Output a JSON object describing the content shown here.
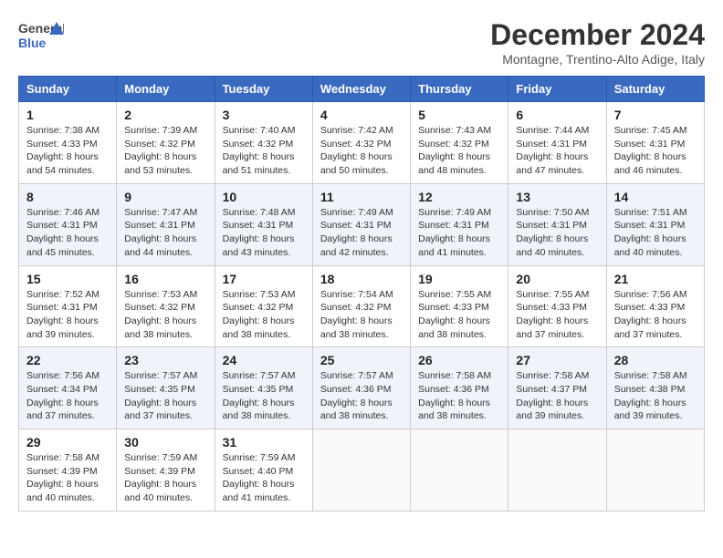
{
  "header": {
    "logo_line1": "General",
    "logo_line2": "Blue",
    "month": "December 2024",
    "location": "Montagne, Trentino-Alto Adige, Italy"
  },
  "days_of_week": [
    "Sunday",
    "Monday",
    "Tuesday",
    "Wednesday",
    "Thursday",
    "Friday",
    "Saturday"
  ],
  "weeks": [
    [
      {
        "day": "1",
        "sunrise": "7:38 AM",
        "sunset": "4:33 PM",
        "daylight": "8 hours and 54 minutes."
      },
      {
        "day": "2",
        "sunrise": "7:39 AM",
        "sunset": "4:32 PM",
        "daylight": "8 hours and 53 minutes."
      },
      {
        "day": "3",
        "sunrise": "7:40 AM",
        "sunset": "4:32 PM",
        "daylight": "8 hours and 51 minutes."
      },
      {
        "day": "4",
        "sunrise": "7:42 AM",
        "sunset": "4:32 PM",
        "daylight": "8 hours and 50 minutes."
      },
      {
        "day": "5",
        "sunrise": "7:43 AM",
        "sunset": "4:32 PM",
        "daylight": "8 hours and 48 minutes."
      },
      {
        "day": "6",
        "sunrise": "7:44 AM",
        "sunset": "4:31 PM",
        "daylight": "8 hours and 47 minutes."
      },
      {
        "day": "7",
        "sunrise": "7:45 AM",
        "sunset": "4:31 PM",
        "daylight": "8 hours and 46 minutes."
      }
    ],
    [
      {
        "day": "8",
        "sunrise": "7:46 AM",
        "sunset": "4:31 PM",
        "daylight": "8 hours and 45 minutes."
      },
      {
        "day": "9",
        "sunrise": "7:47 AM",
        "sunset": "4:31 PM",
        "daylight": "8 hours and 44 minutes."
      },
      {
        "day": "10",
        "sunrise": "7:48 AM",
        "sunset": "4:31 PM",
        "daylight": "8 hours and 43 minutes."
      },
      {
        "day": "11",
        "sunrise": "7:49 AM",
        "sunset": "4:31 PM",
        "daylight": "8 hours and 42 minutes."
      },
      {
        "day": "12",
        "sunrise": "7:49 AM",
        "sunset": "4:31 PM",
        "daylight": "8 hours and 41 minutes."
      },
      {
        "day": "13",
        "sunrise": "7:50 AM",
        "sunset": "4:31 PM",
        "daylight": "8 hours and 40 minutes."
      },
      {
        "day": "14",
        "sunrise": "7:51 AM",
        "sunset": "4:31 PM",
        "daylight": "8 hours and 40 minutes."
      }
    ],
    [
      {
        "day": "15",
        "sunrise": "7:52 AM",
        "sunset": "4:31 PM",
        "daylight": "8 hours and 39 minutes."
      },
      {
        "day": "16",
        "sunrise": "7:53 AM",
        "sunset": "4:32 PM",
        "daylight": "8 hours and 38 minutes."
      },
      {
        "day": "17",
        "sunrise": "7:53 AM",
        "sunset": "4:32 PM",
        "daylight": "8 hours and 38 minutes."
      },
      {
        "day": "18",
        "sunrise": "7:54 AM",
        "sunset": "4:32 PM",
        "daylight": "8 hours and 38 minutes."
      },
      {
        "day": "19",
        "sunrise": "7:55 AM",
        "sunset": "4:33 PM",
        "daylight": "8 hours and 38 minutes."
      },
      {
        "day": "20",
        "sunrise": "7:55 AM",
        "sunset": "4:33 PM",
        "daylight": "8 hours and 37 minutes."
      },
      {
        "day": "21",
        "sunrise": "7:56 AM",
        "sunset": "4:33 PM",
        "daylight": "8 hours and 37 minutes."
      }
    ],
    [
      {
        "day": "22",
        "sunrise": "7:56 AM",
        "sunset": "4:34 PM",
        "daylight": "8 hours and 37 minutes."
      },
      {
        "day": "23",
        "sunrise": "7:57 AM",
        "sunset": "4:35 PM",
        "daylight": "8 hours and 37 minutes."
      },
      {
        "day": "24",
        "sunrise": "7:57 AM",
        "sunset": "4:35 PM",
        "daylight": "8 hours and 38 minutes."
      },
      {
        "day": "25",
        "sunrise": "7:57 AM",
        "sunset": "4:36 PM",
        "daylight": "8 hours and 38 minutes."
      },
      {
        "day": "26",
        "sunrise": "7:58 AM",
        "sunset": "4:36 PM",
        "daylight": "8 hours and 38 minutes."
      },
      {
        "day": "27",
        "sunrise": "7:58 AM",
        "sunset": "4:37 PM",
        "daylight": "8 hours and 39 minutes."
      },
      {
        "day": "28",
        "sunrise": "7:58 AM",
        "sunset": "4:38 PM",
        "daylight": "8 hours and 39 minutes."
      }
    ],
    [
      {
        "day": "29",
        "sunrise": "7:58 AM",
        "sunset": "4:39 PM",
        "daylight": "8 hours and 40 minutes."
      },
      {
        "day": "30",
        "sunrise": "7:59 AM",
        "sunset": "4:39 PM",
        "daylight": "8 hours and 40 minutes."
      },
      {
        "day": "31",
        "sunrise": "7:59 AM",
        "sunset": "4:40 PM",
        "daylight": "8 hours and 41 minutes."
      },
      null,
      null,
      null,
      null
    ]
  ],
  "labels": {
    "sunrise_prefix": "Sunrise: ",
    "sunset_prefix": "Sunset: ",
    "daylight_prefix": "Daylight: "
  }
}
